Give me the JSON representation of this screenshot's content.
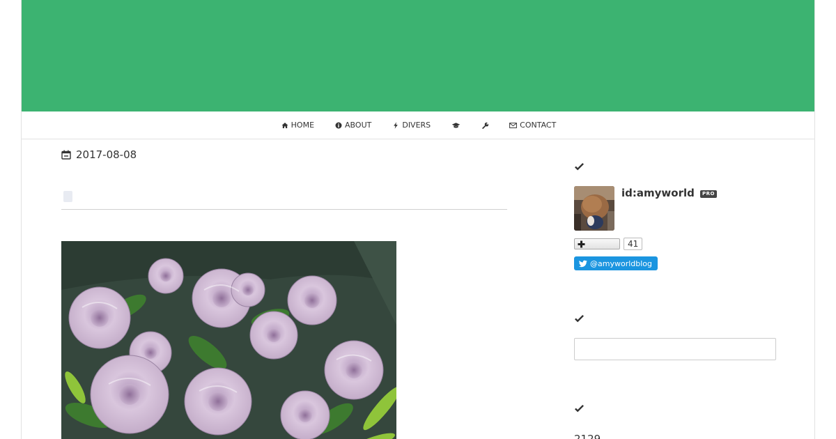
{
  "colors": {
    "header_banner": "#3cb371",
    "twitter": "#1b95e0",
    "text": "#333333"
  },
  "nav": {
    "items": [
      {
        "label": "HOME",
        "icon": "home-icon"
      },
      {
        "label": "ABOUT",
        "icon": "info-circle-icon"
      },
      {
        "label": "DIVERS",
        "icon": "bolt-icon"
      },
      {
        "label": "",
        "icon": "graduation-cap-icon"
      },
      {
        "label": "",
        "icon": "wrench-icon"
      },
      {
        "label": "CONTACT",
        "icon": "envelope-icon"
      }
    ]
  },
  "post": {
    "date": "2017-08-08",
    "date_icon": "calendar-icon",
    "image": "lavender-roses-photo"
  },
  "sidebar": {
    "section_icon": "check-icon",
    "profile": {
      "user_id": "id:amyworld",
      "badge": "PRO",
      "avatar": "user-avatar-photo",
      "subscribe_icon": "plus-icon",
      "subscriber_count": "41",
      "twitter_handle": "@amyworldblog",
      "twitter_icon": "twitter-bird-icon"
    },
    "search": {
      "value": "",
      "placeholder": ""
    },
    "counter": {
      "value": "2129"
    }
  }
}
